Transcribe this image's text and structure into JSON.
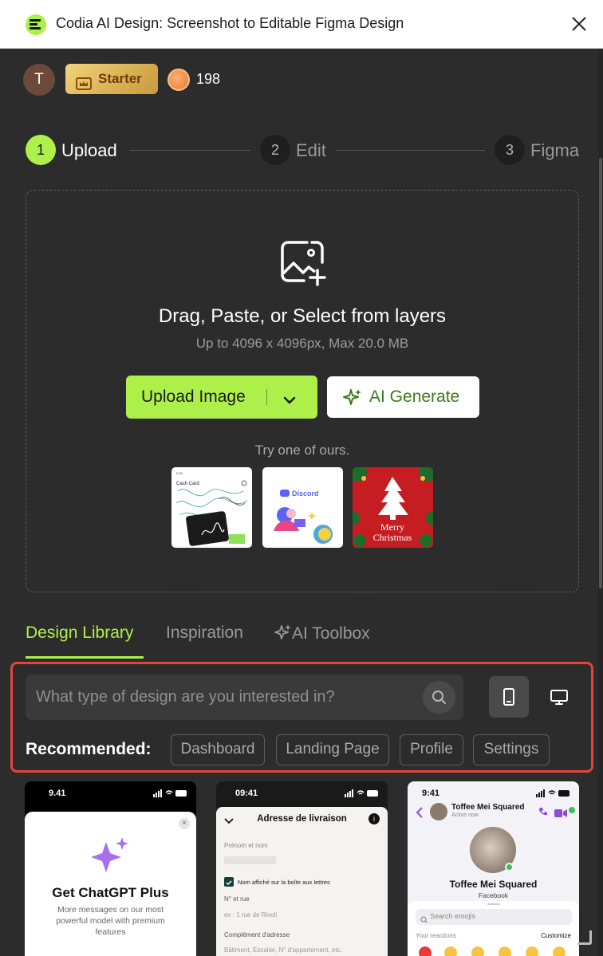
{
  "window": {
    "title": "Codia AI Design: Screenshot to Editable Figma Design"
  },
  "account": {
    "avatar_initial": "T",
    "plan": "Starter",
    "credits": "198"
  },
  "steps": [
    {
      "num": "1",
      "label": "Upload"
    },
    {
      "num": "2",
      "label": "Edit"
    },
    {
      "num": "3",
      "label": "Figma"
    }
  ],
  "upload": {
    "title": "Drag, Paste, or Select from layers",
    "subtitle": "Up to 4096 x 4096px, Max 20.0 MB",
    "upload_button": "Upload Image",
    "ai_button": "AI Generate",
    "try_label": "Try one of ours.",
    "samples": {
      "cash": {
        "title": "Cash Card",
        "time": "5:55"
      },
      "discord": {
        "title": "Discord"
      },
      "xmas": {
        "line1": "Merry",
        "line2": "Christmas"
      }
    }
  },
  "tabs": [
    "Design Library",
    "Inspiration",
    "AI Toolbox"
  ],
  "search": {
    "placeholder": "What type of design are you interested in?"
  },
  "recommended": {
    "label": "Recommended:",
    "chips": [
      "Dashboard",
      "Landing Page",
      "Profile",
      "Settings"
    ]
  },
  "cards": [
    {
      "time": "9.41",
      "title": "Get ChatGPT Plus",
      "description": "More messages on our most powerful model with premium features"
    },
    {
      "time": "09:41",
      "title": "Adresse de livraison",
      "field1": "Prénom et nom",
      "checkbox": "Nom affiché sur la boîte aux lettres",
      "field2": "N° et rue",
      "field2_placeholder": "ex : 1 rue de Rivoli",
      "field3": "Complément d'adresse",
      "field3_placeholder": "Bâtiment, Escalier, N° d'appartement, etc."
    },
    {
      "time": "9:41",
      "header_name": "Toffee Mei Squared",
      "header_status": "Active now",
      "profile_name": "Toffee Mei Squared",
      "profile_sub": "Facebook",
      "search_placeholder": "Search emojis",
      "reactions_label": "Your reactions",
      "customize": "Customize"
    }
  ],
  "colors": {
    "accent": "#aef04a",
    "background": "#2c2c2c",
    "highlight": "#e5443b"
  }
}
